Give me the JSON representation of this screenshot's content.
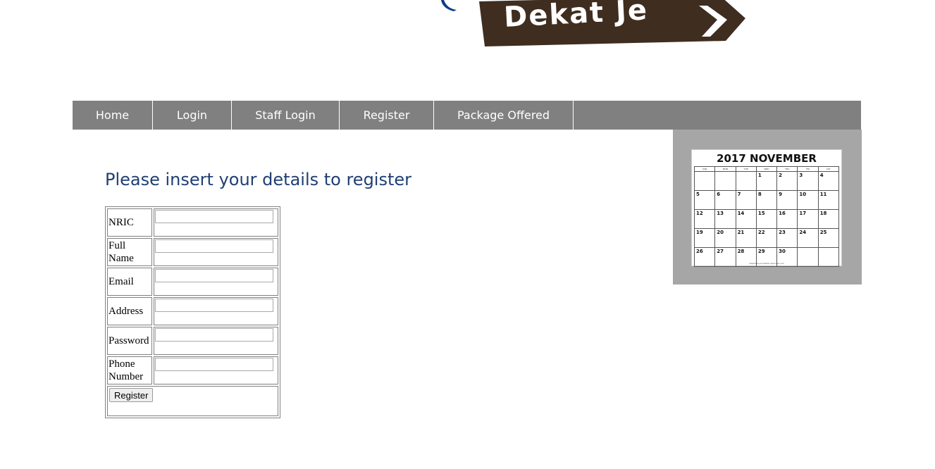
{
  "logo": {
    "text": "Dekat Je",
    "sign_color": "#3f2d20",
    "swoosh_color": "#0d3b8a"
  },
  "nav": {
    "items": [
      {
        "label": "Home"
      },
      {
        "label": "Login"
      },
      {
        "label": "Staff Login"
      },
      {
        "label": "Register"
      },
      {
        "label": "Package Offered"
      }
    ]
  },
  "calendar": {
    "title": "2017  NOVEMBER",
    "weekdays": [
      "SUN",
      "MON",
      "TUE",
      "WED",
      "THU",
      "FRI",
      "SAT"
    ],
    "weeks": [
      [
        "",
        "",
        "",
        "1",
        "2",
        "3",
        "4"
      ],
      [
        "5",
        "6",
        "7",
        "8",
        "9",
        "10",
        "11"
      ],
      [
        "12",
        "13",
        "14",
        "15",
        "16",
        "17",
        "18"
      ],
      [
        "19",
        "20",
        "21",
        "22",
        "23",
        "24",
        "25"
      ],
      [
        "26",
        "27",
        "28",
        "29",
        "30",
        "",
        ""
      ]
    ],
    "footer": "www.free-printable-calendar.com"
  },
  "page": {
    "heading": "Please insert your details to register"
  },
  "form": {
    "fields": [
      {
        "label": "NRIC",
        "value": ""
      },
      {
        "label": "Full Name",
        "value": ""
      },
      {
        "label": "Email",
        "value": ""
      },
      {
        "label": "Address",
        "value": ""
      },
      {
        "label": "Password",
        "value": ""
      },
      {
        "label": "Phone Number",
        "value": ""
      }
    ],
    "submit_label": "Register"
  }
}
